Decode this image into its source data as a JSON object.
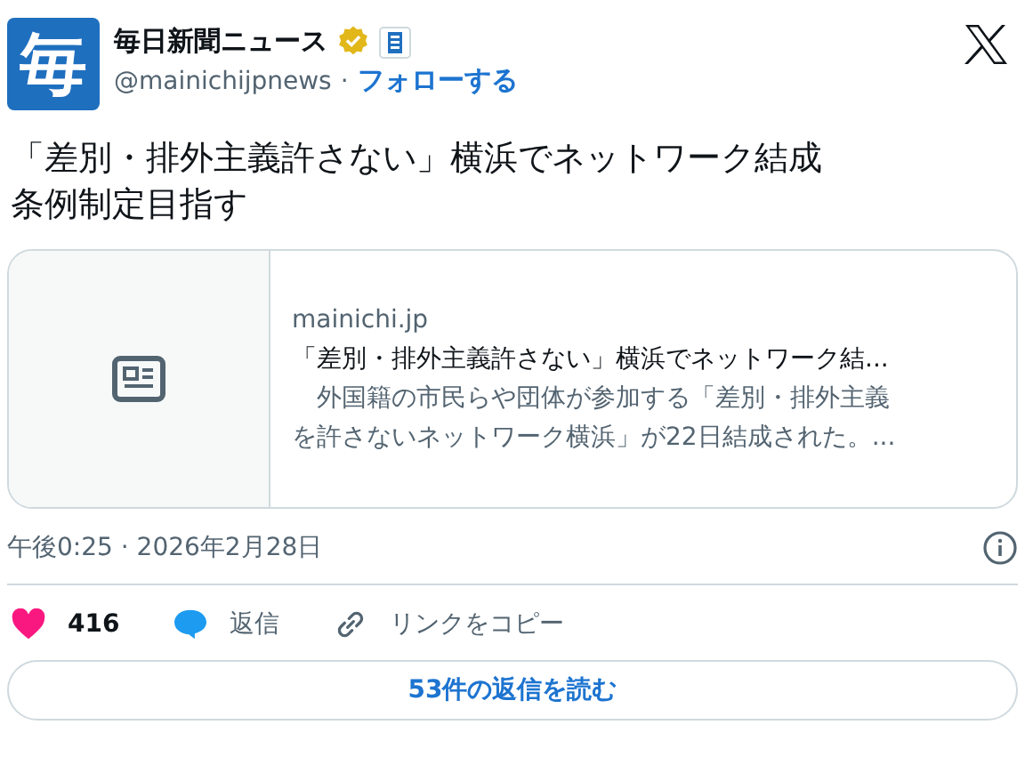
{
  "account": {
    "avatar_text": "毎",
    "name": "毎日新聞ニュース",
    "verified": true,
    "handle": "@mainichijpnews",
    "separator": "·",
    "follow": "フォローする"
  },
  "tweet_text_lines": [
    "「差別・排外主義許さない」横浜でネットワーク結成",
    "条例制定目指す"
  ],
  "link_card": {
    "domain": "mainichi.jp",
    "title": "「差別・排外主義許さない」横浜でネットワーク結...",
    "description_lines": [
      "　外国籍の市民らや団体が参加する「差別・排外主義",
      "を許さないネットワーク横浜」が22日結成された。..."
    ]
  },
  "timestamp": "午後0:25 · 2026年2月28日",
  "actions": [
    {
      "kind": "like",
      "label": "416"
    },
    {
      "kind": "reply",
      "label": "返信"
    },
    {
      "kind": "copy",
      "label": "リンクをコピー"
    }
  ],
  "read_replies": "53件の返信を読む"
}
